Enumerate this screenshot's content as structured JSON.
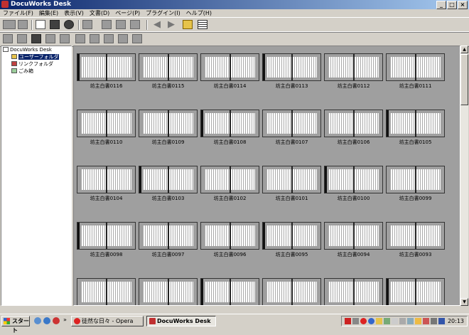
{
  "window": {
    "title": "DocuWorks Desk",
    "buttons": [
      "_",
      "□",
      "×"
    ]
  },
  "menu": [
    "ファイル(F)",
    "編集(E)",
    "表示(V)",
    "文書(D)",
    "ページ(P)",
    "プラグイン(I)",
    "ヘルプ(H)"
  ],
  "tree": {
    "root": "DocuWorks Desk",
    "items": [
      {
        "label": "ユーザーフォルダ",
        "icon": "folder-open-icon",
        "selected": true
      },
      {
        "label": "リンクフォルダ",
        "icon": "link-folder-icon",
        "selected": false
      },
      {
        "label": "ごみ箱",
        "icon": "trash-icon",
        "selected": false
      }
    ]
  },
  "documents": [
    "坊主白書0116",
    "坊主白書0115",
    "坊主白書0114",
    "坊主白書0113",
    "坊主白書0112",
    "坊主白書0111",
    "坊主白書0110",
    "坊主白書0109",
    "坊主白書0108",
    "坊主白書0107",
    "坊主白書0106",
    "坊主白書0105",
    "坊主白書0104",
    "坊主白書0103",
    "坊主白書0102",
    "坊主白書0101",
    "坊主白書0100",
    "坊主白書0099",
    "坊主白書0098",
    "坊主白書0097",
    "坊主白書0096",
    "坊主白書0095",
    "坊主白書0094",
    "坊主白書0093",
    "",
    "",
    "",
    "",
    "",
    ""
  ],
  "taskbar": {
    "start": "スタート",
    "tasks": [
      {
        "label": "徒然な日々 - Opera",
        "active": false
      },
      {
        "label": "DocuWorks Desk",
        "active": true
      }
    ],
    "clock": "20:13"
  }
}
